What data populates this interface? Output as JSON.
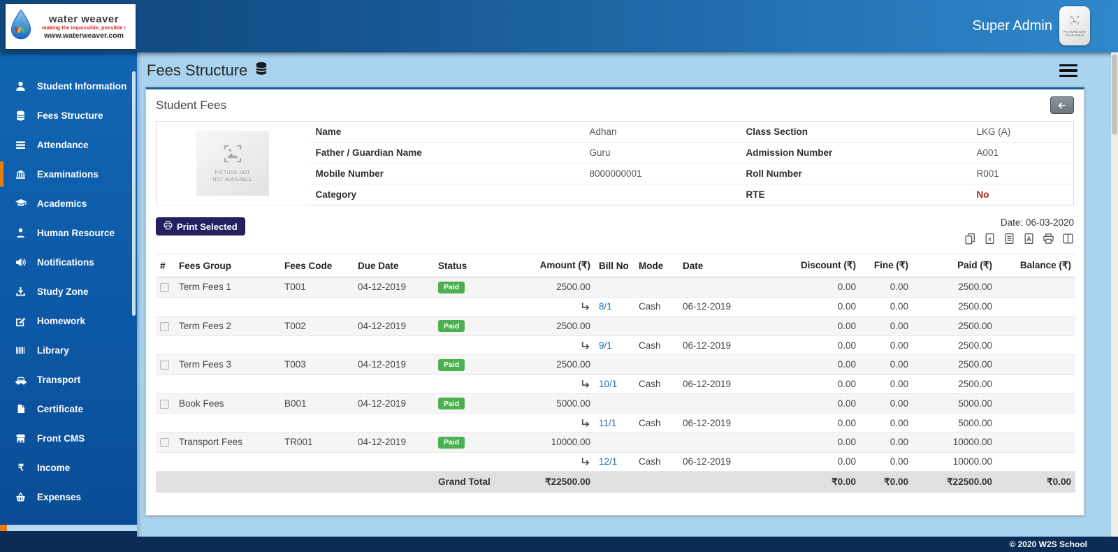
{
  "brand": {
    "name": "water weaver",
    "tagline": "making the impossible, possible !",
    "url": "www.waterweaver.com"
  },
  "header": {
    "user_name": "Super Admin",
    "avatar_placeholder": "PICTURE NOT AVAILABLE"
  },
  "sidebar": {
    "items": [
      {
        "label": "Student Information",
        "icon": "user",
        "active": false
      },
      {
        "label": "Fees Structure",
        "icon": "database",
        "active": false
      },
      {
        "label": "Attendance",
        "icon": "list",
        "active": false
      },
      {
        "label": "Examinations",
        "icon": "bank",
        "active": true
      },
      {
        "label": "Academics",
        "icon": "graduation-cap",
        "active": false
      },
      {
        "label": "Human Resource",
        "icon": "user-tie",
        "active": false
      },
      {
        "label": "Notifications",
        "icon": "speaker",
        "active": false
      },
      {
        "label": "Study Zone",
        "icon": "download",
        "active": false
      },
      {
        "label": "Homework",
        "icon": "pencil-square",
        "active": false
      },
      {
        "label": "Library",
        "icon": "barcode",
        "active": false
      },
      {
        "label": "Transport",
        "icon": "car",
        "active": false
      },
      {
        "label": "Certificate",
        "icon": "file",
        "active": false
      },
      {
        "label": "Front CMS",
        "icon": "storefront",
        "active": false
      },
      {
        "label": "Income",
        "icon": "rupee",
        "active": false
      },
      {
        "label": "Expenses",
        "icon": "basket",
        "active": false
      }
    ]
  },
  "page": {
    "title": "Fees Structure"
  },
  "card": {
    "title": "Student Fees"
  },
  "student": {
    "photo_placeholder": "PICTURE NOT AVAILABLE",
    "rows": [
      {
        "l1": "Name",
        "v1": "Adhan",
        "l2": "Class Section",
        "v2": "LKG (A)",
        "v2_highlight": false
      },
      {
        "l1": "Father / Guardian Name",
        "v1": "Guru",
        "l2": "Admission Number",
        "v2": "A001",
        "v2_highlight": false
      },
      {
        "l1": "Mobile Number",
        "v1": "8000000001",
        "l2": "Roll Number",
        "v2": "R001",
        "v2_highlight": false
      },
      {
        "l1": "Category",
        "v1": "",
        "l2": "RTE",
        "v2": "No",
        "v2_highlight": true
      }
    ]
  },
  "toolbar": {
    "print_selected": "Print Selected",
    "date_label": "Date: 06-03-2020",
    "export_icons": [
      "copy",
      "excel",
      "csv",
      "pdf",
      "print",
      "columns"
    ]
  },
  "fees_table": {
    "headers": [
      "#",
      "Fees Group",
      "Fees Code",
      "Due Date",
      "Status",
      "Amount (₹)",
      "Bill No",
      "Mode",
      "Date",
      "Discount (₹)",
      "Fine (₹)",
      "Paid (₹)",
      "Balance (₹)"
    ],
    "rows": [
      {
        "fees_group": "Term Fees 1",
        "fees_code": "T001",
        "due_date": "04-12-2019",
        "status": "Paid",
        "amount": "2500.00",
        "discount": "0.00",
        "fine": "0.00",
        "paid": "2500.00",
        "balance": "",
        "payment": {
          "bill_no": "8/1",
          "mode": "Cash",
          "date": "06-12-2019",
          "discount": "0.00",
          "fine": "0.00",
          "paid": "2500.00",
          "balance": ""
        }
      },
      {
        "fees_group": "Term Fees 2",
        "fees_code": "T002",
        "due_date": "04-12-2019",
        "status": "Paid",
        "amount": "2500.00",
        "discount": "0.00",
        "fine": "0.00",
        "paid": "2500.00",
        "balance": "",
        "payment": {
          "bill_no": "9/1",
          "mode": "Cash",
          "date": "06-12-2019",
          "discount": "0.00",
          "fine": "0.00",
          "paid": "2500.00",
          "balance": ""
        }
      },
      {
        "fees_group": "Term Fees 3",
        "fees_code": "T003",
        "due_date": "04-12-2019",
        "status": "Paid",
        "amount": "2500.00",
        "discount": "0.00",
        "fine": "0.00",
        "paid": "2500.00",
        "balance": "",
        "payment": {
          "bill_no": "10/1",
          "mode": "Cash",
          "date": "06-12-2019",
          "discount": "0.00",
          "fine": "0.00",
          "paid": "2500.00",
          "balance": ""
        }
      },
      {
        "fees_group": "Book Fees",
        "fees_code": "B001",
        "due_date": "04-12-2019",
        "status": "Paid",
        "amount": "5000.00",
        "discount": "0.00",
        "fine": "0.00",
        "paid": "5000.00",
        "balance": "",
        "payment": {
          "bill_no": "11/1",
          "mode": "Cash",
          "date": "06-12-2019",
          "discount": "0.00",
          "fine": "0.00",
          "paid": "5000.00",
          "balance": ""
        }
      },
      {
        "fees_group": "Transport Fees",
        "fees_code": "TR001",
        "due_date": "04-12-2019",
        "status": "Paid",
        "amount": "10000.00",
        "discount": "0.00",
        "fine": "0.00",
        "paid": "10000.00",
        "balance": "",
        "payment": {
          "bill_no": "12/1",
          "mode": "Cash",
          "date": "06-12-2019",
          "discount": "0.00",
          "fine": "0.00",
          "paid": "10000.00",
          "balance": ""
        }
      }
    ],
    "grand_total": {
      "label": "Grand Total",
      "amount": "₹22500.00",
      "discount": "₹0.00",
      "fine": "₹0.00",
      "paid": "₹22500.00",
      "balance": "₹0.00"
    }
  },
  "footer": {
    "copyright": "© 2020 W2S School"
  },
  "colors": {
    "header_blue": "#2f87c9",
    "sidebar_blue": "#0c57a4",
    "content_bg": "#a9d3ef",
    "active_accent_orange": "#e87e0e",
    "paid_green": "#4caf50",
    "link_blue": "#1e6fb7",
    "rte_red": "#a3251f",
    "print_button_indigo": "#262063",
    "footer_navy": "#0a2c55"
  }
}
